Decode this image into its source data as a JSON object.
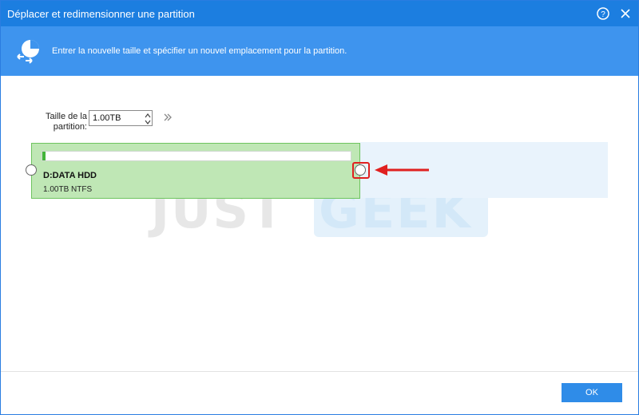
{
  "window": {
    "title": "Déplacer et redimensionner une partition",
    "help_icon": "help-circle-icon",
    "close_icon": "close-icon"
  },
  "banner": {
    "icon": "partition-move-icon",
    "text": "Entrer la nouvelle taille et spécifier un nouvel emplacement pour la partition."
  },
  "size": {
    "label": "Taille de la partition:",
    "value": "1.00TB",
    "expand_icon": "double-chevron-right-icon"
  },
  "partition": {
    "name": "D:DATA HDD",
    "info": "1.00TB NTFS",
    "used_fraction": 0.01
  },
  "watermark": {
    "part1": "JUST",
    "part2": "GEEK"
  },
  "footer": {
    "ok_label": "OK"
  },
  "colors": {
    "titlebar": "#1c7ee0",
    "banner": "#3e94ee",
    "partition_fill": "#bfe7b5",
    "usage_fill": "#43b53a",
    "annotation": "#e02020"
  }
}
